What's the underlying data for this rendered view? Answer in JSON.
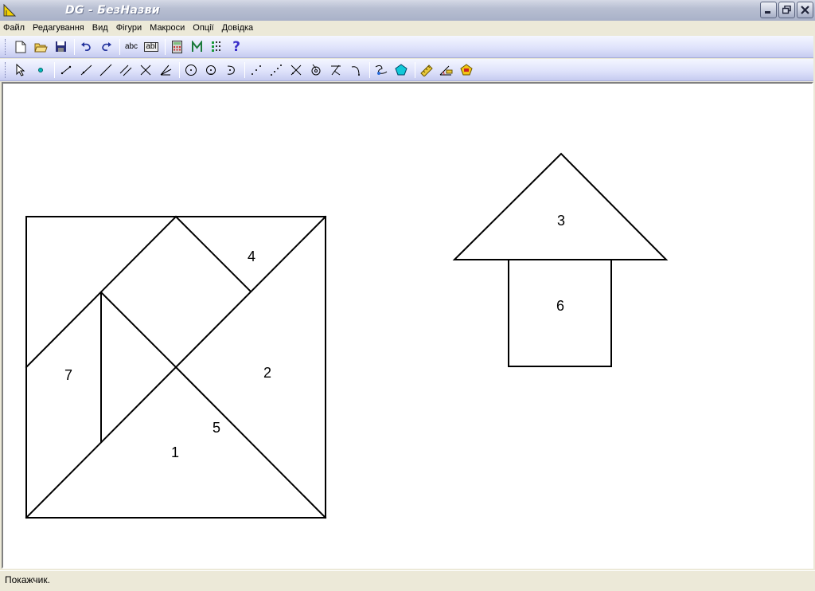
{
  "window": {
    "title": "DG - БезНазви"
  },
  "menu": [
    "Файл",
    "Редагування",
    "Вид",
    "Фігури",
    "Макроси",
    "Опції",
    "Довідка"
  ],
  "toolbar1": {
    "text_tool_label": "abc",
    "label_tool_label": "abl",
    "help_label": "?"
  },
  "toolbar2": {
    "tools": [
      "pointer",
      "point",
      "segment",
      "ray",
      "line",
      "parallel-line",
      "intersection",
      "angle-bisector",
      "circle-center-point",
      "circle-center-radius",
      "arc",
      "midpoint",
      "divide-segment",
      "perpendicular-bisector",
      "circle-center",
      "reflect",
      "rotate",
      "locus",
      "polygon",
      "measure",
      "calculate-angle",
      "area"
    ]
  },
  "drawing": {
    "tangram_labels": [
      "1",
      "2",
      "4",
      "5",
      "7"
    ],
    "house_labels": [
      "3",
      "6"
    ]
  },
  "status": {
    "text": "Покажчик."
  }
}
